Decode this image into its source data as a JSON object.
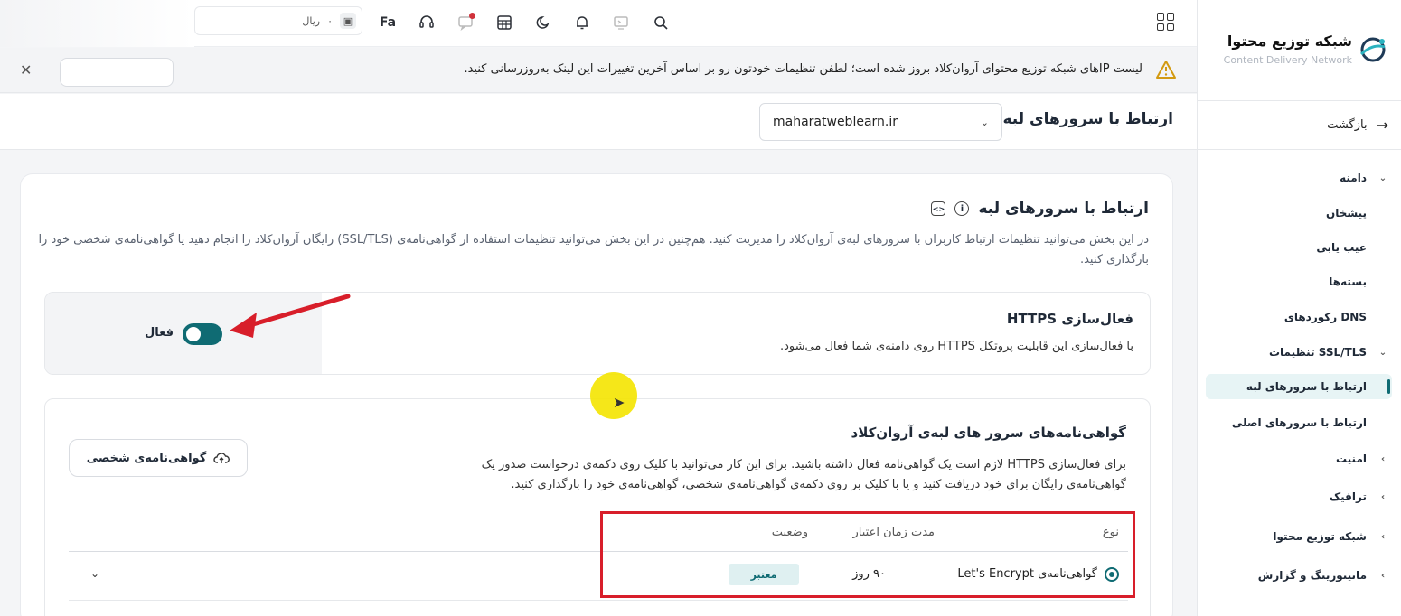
{
  "sidebar": {
    "brand_title": "شبکه توزیع محتوا",
    "brand_subtitle": "Content Delivery Network",
    "back_label": "بازگشت",
    "items": [
      {
        "label": "دامنه",
        "type": "parent"
      },
      {
        "label": "پیشخان",
        "type": "child"
      },
      {
        "label": "عیب یابی",
        "type": "child"
      },
      {
        "label": "بسته‌ها",
        "type": "child"
      },
      {
        "label": "رکوردهای DNS",
        "type": "child"
      },
      {
        "label": "تنظیمات SSL/TLS",
        "type": "parent"
      },
      {
        "label": "ارتباط با سرورهای لبه",
        "type": "child",
        "active": true
      },
      {
        "label": "ارتباط با سرورهای اصلی",
        "type": "child"
      },
      {
        "label": "امنیت",
        "type": "parent"
      },
      {
        "label": "ترافیک",
        "type": "parent"
      },
      {
        "label": "شبکه توزیع محتوا",
        "type": "parent"
      },
      {
        "label": "مانیتورینگ و گزارش",
        "type": "parent"
      }
    ]
  },
  "topbar": {
    "wallet_value": "۰",
    "wallet_currency": "ریال",
    "language": "Fa"
  },
  "banner": {
    "text": "لیست IPهای شبکه توزیع محتوای آروان‌کلاد بروز شده است؛ لطفن تنظیمات خودتون رو بر اساس آخرین تغییرات این لینک به‌روزرسانی کنید."
  },
  "page": {
    "title": "ارتباط با سرورهای لبه",
    "domain": "maharatweblearn.ir"
  },
  "section": {
    "title": "ارتباط با سرورهای لبه",
    "description": "در این بخش می‌توانید تنظیمات ارتباط کاربران با سرورهای لبه‌ی آروان‌کلاد را مدیریت کنید. هم‌چنین در این بخش می‌توانید تنظیمات استفاده از گواهی‌نامه‌ی (SSL/TLS) رایگان آروان‌کلاد را انجام دهید یا گواهی‌نامه‌ی شخصی خود را بارگذاری کنید."
  },
  "https": {
    "title": "فعال‌سازی HTTPS",
    "description": "با فعال‌سازی این قابلیت پروتکل HTTPS روی دامنه‌ی شما فعال می‌شود.",
    "toggle_label": "فعال",
    "enabled": true
  },
  "certificates": {
    "title": "گواهی‌نامه‌های سرور های لبه‌ی آروان‌کلاد",
    "description": "برای فعال‌سازی HTTPS لازم است یک گواهی‌نامه فعال داشته باشید. برای این کار می‌توانید با کلیک روی دکمه‌ی درخواست صدور یک گواهی‌نامه‌ی رایگان برای خود دریافت کنید و یا با کلیک بر روی دکمه‌ی گواهی‌نامه‌ی شخصی، گواهی‌نامه‌ی خود را بارگذاری کنید.",
    "personal_button": "گواهی‌نامه‌ی شخصی",
    "columns": [
      "نوع",
      "مدت زمان اعتبار",
      "وضعیت"
    ],
    "rows": [
      {
        "type": "گواهی‌نامه‌ی Let's Encrypt",
        "validity": "۹۰ روز",
        "status": "معتبر"
      }
    ]
  }
}
